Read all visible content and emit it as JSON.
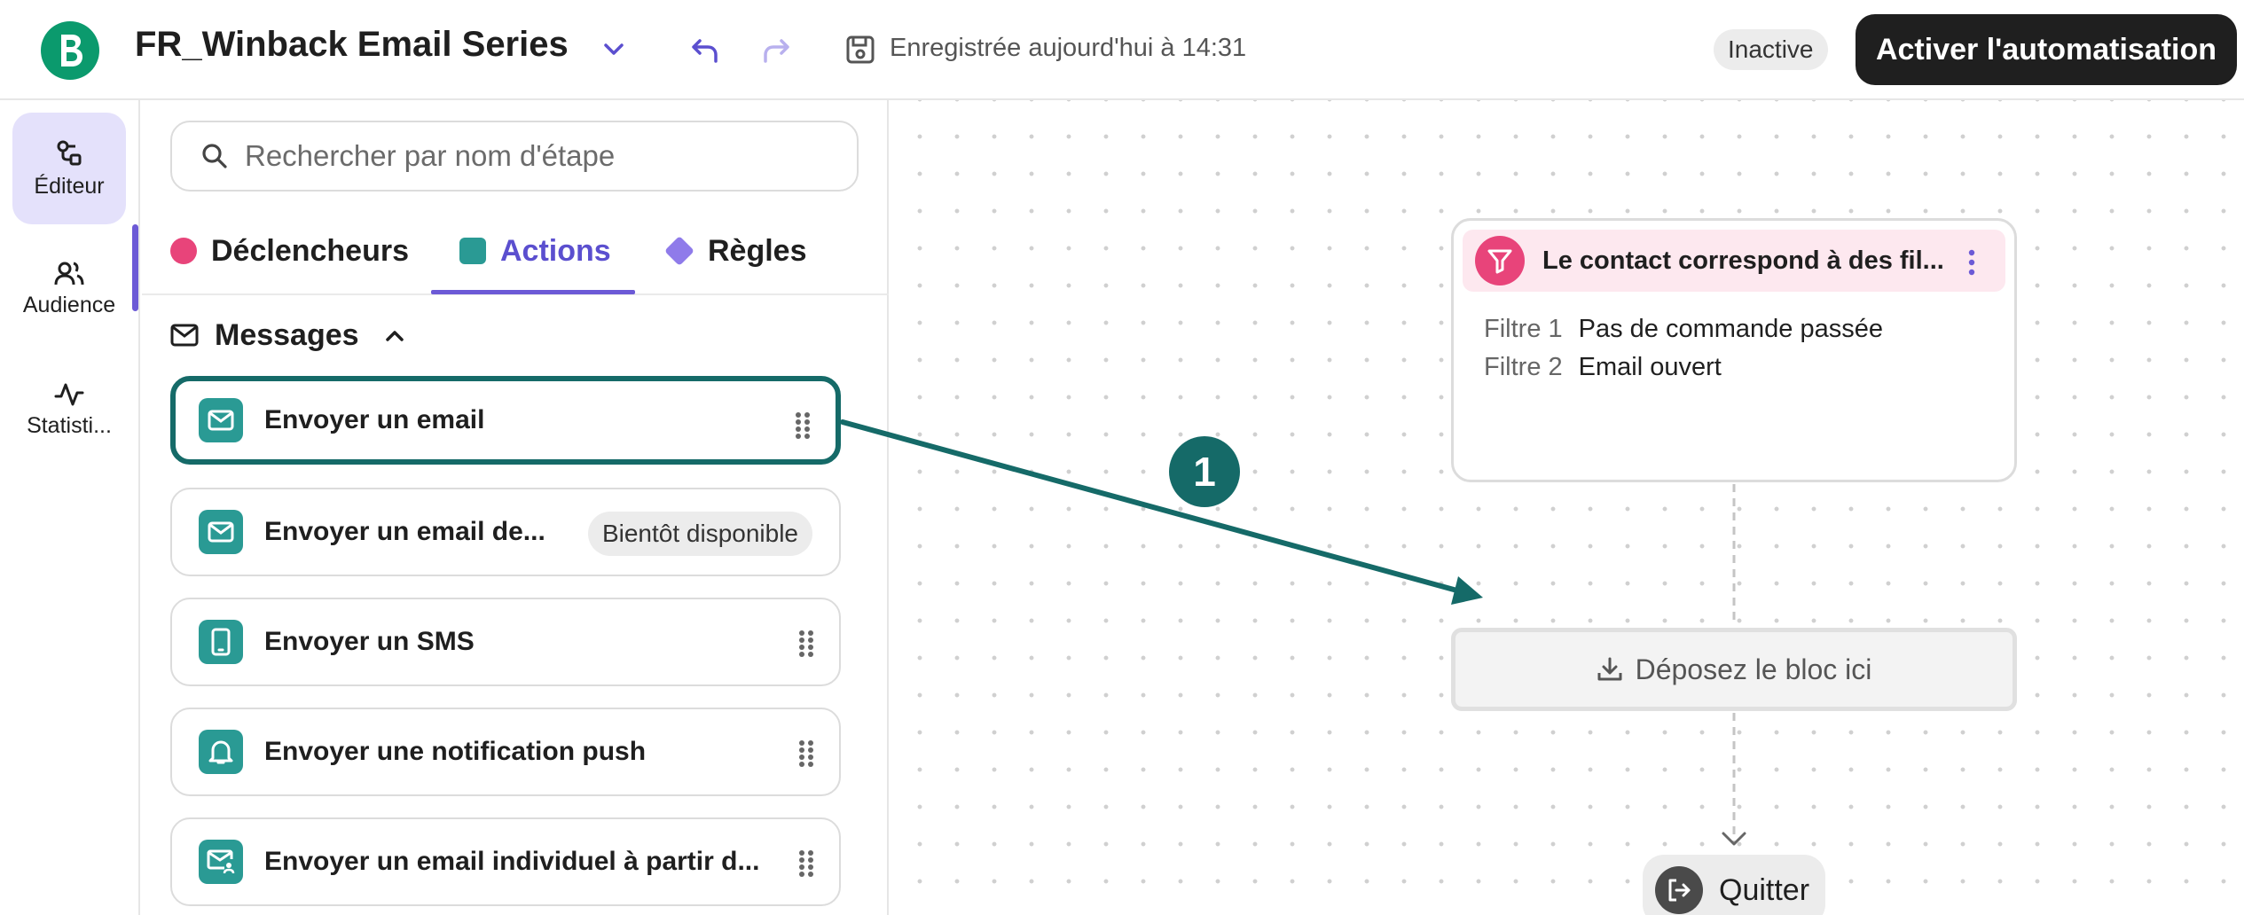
{
  "header": {
    "title": "FR_Winback Email Series",
    "saved_text": "Enregistrée aujourd'hui à 14:31",
    "status": "Inactive",
    "activate_label": "Activer l'automatisation"
  },
  "rail": {
    "items": [
      {
        "label": "Éditeur",
        "icon": "editor-icon"
      },
      {
        "label": "Audience",
        "icon": "users-icon"
      },
      {
        "label": "Statisti...",
        "icon": "activity-icon"
      }
    ]
  },
  "panel": {
    "search_placeholder": "Rechercher par nom d'étape",
    "tabs": [
      {
        "label": "Déclencheurs"
      },
      {
        "label": "Actions"
      },
      {
        "label": "Règles"
      }
    ],
    "section_title": "Messages",
    "actions": [
      {
        "label": "Envoyer un email",
        "icon": "mail-icon"
      },
      {
        "label": "Envoyer un email de...",
        "icon": "mail-icon",
        "badge": "Bientôt disponible"
      },
      {
        "label": "Envoyer un SMS",
        "icon": "phone-icon"
      },
      {
        "label": "Envoyer une notification push",
        "icon": "bell-icon"
      },
      {
        "label": "Envoyer un email individuel à partir d...",
        "icon": "mail-user-icon"
      }
    ]
  },
  "canvas": {
    "filter_node": {
      "title": "Le contact correspond à des fil...",
      "filters": [
        {
          "key": "Filtre 1",
          "value": "Pas de commande passée"
        },
        {
          "key": "Filtre 2",
          "value": "Email ouvert"
        }
      ]
    },
    "drop_zone_label": "Déposez le bloc ici",
    "quit_label": "Quitter",
    "step_badge": "1"
  },
  "colors": {
    "brand": "#0b9a6d",
    "accent": "#6c5ad6",
    "action_teal": "#2a9a94",
    "annotation": "#156a68",
    "trigger_pink": "#e8447a"
  }
}
